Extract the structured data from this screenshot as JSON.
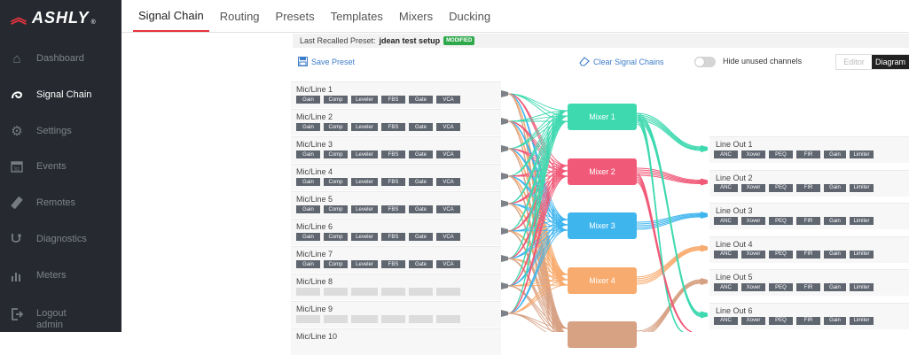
{
  "brand": {
    "name": "ASHLY",
    "mark": "®"
  },
  "sidebar": {
    "items": [
      {
        "label": "Dashboard",
        "icon": "home-icon"
      },
      {
        "label": "Signal Chain",
        "icon": "signal-chain-icon"
      },
      {
        "label": "Settings",
        "icon": "gear-icon"
      },
      {
        "label": "Events",
        "icon": "calendar-icon"
      },
      {
        "label": "Remotes",
        "icon": "remote-icon"
      },
      {
        "label": "Diagnostics",
        "icon": "stethoscope-icon"
      },
      {
        "label": "Meters",
        "icon": "meters-icon"
      },
      {
        "label": "Logout",
        "sub": "admin",
        "icon": "logout-icon"
      }
    ]
  },
  "tabs": [
    "Signal Chain",
    "Routing",
    "Presets",
    "Templates",
    "Mixers",
    "Ducking"
  ],
  "status": {
    "prefix": "Last Recalled Preset:",
    "preset": "jdean test setup",
    "badge": "MODIFIED"
  },
  "toolbar": {
    "save_preset": "Save Preset",
    "clear_chains": "Clear Signal Chains",
    "hide_unused": "Hide unused channels",
    "hide_unused_on": false,
    "view_editor": "Editor",
    "view_diagram": "Diagram"
  },
  "inputs": [
    {
      "name": "Mic/Line 1",
      "blocks": [
        "Gain",
        "Comp",
        "Leveler",
        "FBS",
        "Gate",
        "VCA"
      ]
    },
    {
      "name": "Mic/Line 2",
      "blocks": [
        "Gain",
        "Comp",
        "Leveler",
        "FBS",
        "Gate",
        "VCA"
      ]
    },
    {
      "name": "Mic/Line 3",
      "blocks": [
        "Gain",
        "Comp",
        "Leveler",
        "FBS",
        "Gate",
        "VCA"
      ]
    },
    {
      "name": "Mic/Line 4",
      "blocks": [
        "Gain",
        "Comp",
        "Leveler",
        "FBS",
        "Gate",
        "VCA"
      ]
    },
    {
      "name": "Mic/Line 5",
      "blocks": [
        "Gain",
        "Comp",
        "Leveler",
        "FBS",
        "Gate",
        "VCA"
      ]
    },
    {
      "name": "Mic/Line 6",
      "blocks": [
        "Gain",
        "Comp",
        "Leveler",
        "FBS",
        "Gate",
        "VCA"
      ]
    },
    {
      "name": "Mic/Line 7",
      "blocks": [
        "Gain",
        "Comp",
        "Leveler",
        "FBS",
        "Gate",
        "VCA"
      ]
    },
    {
      "name": "Mic/Line 8",
      "blocks": [
        "",
        "",
        "",
        "",
        "",
        ""
      ]
    },
    {
      "name": "Mic/Line 9",
      "blocks": [
        "",
        "",
        "",
        "",
        "",
        ""
      ]
    },
    {
      "name": "Mic/Line 10",
      "blocks": []
    }
  ],
  "mixers": [
    {
      "name": "Mixer 1",
      "color": "#3fd9b0"
    },
    {
      "name": "Mixer 2",
      "color": "#f05a78"
    },
    {
      "name": "Mixer 3",
      "color": "#3fb5ee"
    },
    {
      "name": "Mixer 4",
      "color": "#f8ab6e"
    },
    {
      "name": "",
      "color": "#d7a184"
    }
  ],
  "outputs": [
    {
      "name": "Line Out 1",
      "blocks": [
        "ANC",
        "Xover",
        "PEQ",
        "FIR",
        "Gain",
        "Limiter"
      ],
      "color": "#3fd9b0"
    },
    {
      "name": "Line Out 2",
      "blocks": [
        "ANC",
        "Xover",
        "PEQ",
        "FIR",
        "Gain",
        "Limiter"
      ],
      "color": "#f05a78"
    },
    {
      "name": "Line Out 3",
      "blocks": [
        "ANC",
        "Xover",
        "PEQ",
        "FIR",
        "Gain",
        "Limiter"
      ],
      "color": "#3fb5ee"
    },
    {
      "name": "Line Out 4",
      "blocks": [
        "ANC",
        "Xover",
        "PEQ",
        "FIR",
        "Gain",
        "Limiter"
      ],
      "color": "#f8ab6e"
    },
    {
      "name": "Line Out 5",
      "blocks": [
        "ANC",
        "Xover",
        "PEQ",
        "FIR",
        "Gain",
        "Limiter"
      ],
      "color": "#d7a184"
    },
    {
      "name": "Line Out 6",
      "blocks": [
        "ANC",
        "Xover",
        "PEQ",
        "FIR",
        "Gain",
        "Limiter"
      ],
      "color": "#3fd9b0"
    }
  ]
}
